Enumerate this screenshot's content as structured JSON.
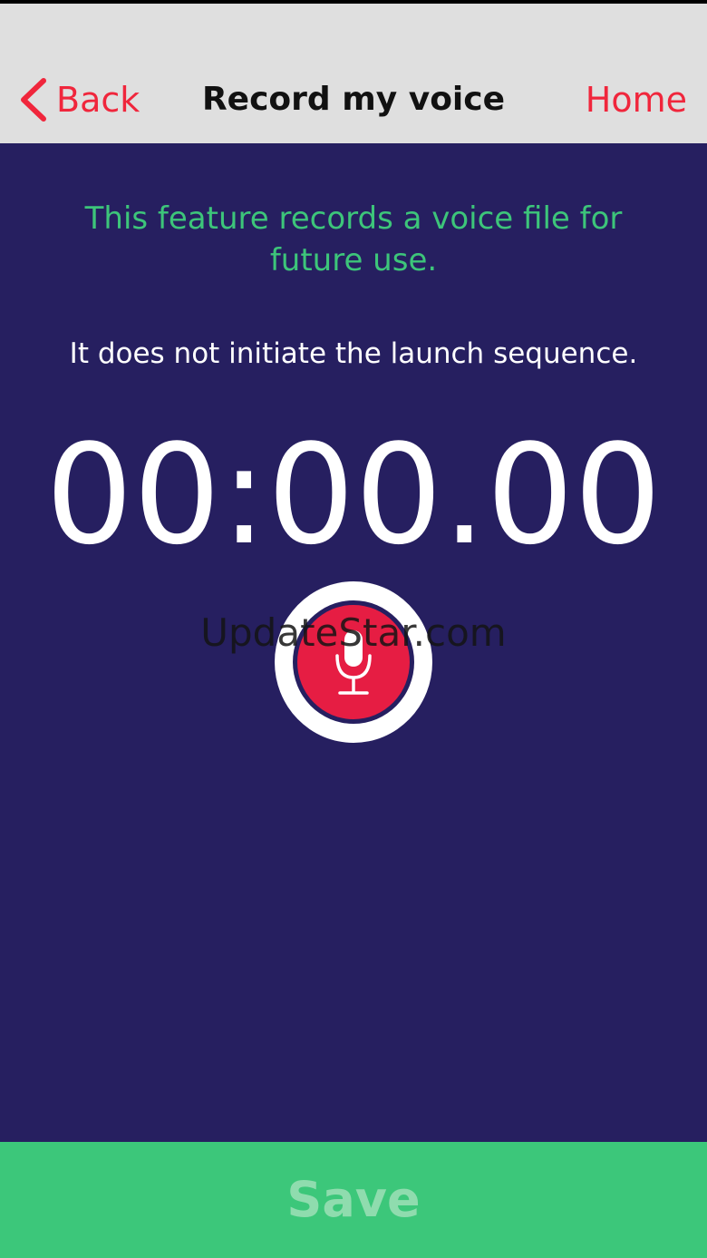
{
  "navbar": {
    "back_label": "Back",
    "title": "Record my voice",
    "home_label": "Home"
  },
  "content": {
    "info_primary": "This feature records a voice file for future use.",
    "info_secondary": "It does not initiate the launch sequence.",
    "timer": "00:00.00"
  },
  "record": {
    "icon": "microphone-icon"
  },
  "watermark": "UpdateStar.com",
  "footer": {
    "save_label": "Save"
  },
  "colors": {
    "accent_red": "#f0263c",
    "record_red": "#e61d43",
    "green": "#3dc57a",
    "background": "#261f60",
    "navbar": "#dfdfdf"
  }
}
